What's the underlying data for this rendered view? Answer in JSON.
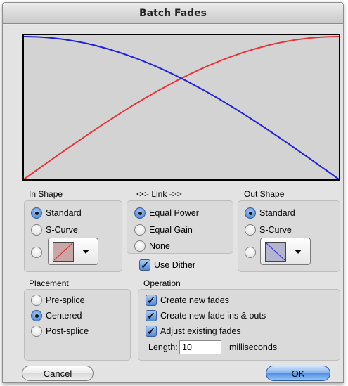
{
  "window": {
    "title": "Batch Fades"
  },
  "curves": {
    "in_color": "#e8333a",
    "out_color": "#1d1ee0",
    "background": "#d3d3d3"
  },
  "in_shape": {
    "label": "In Shape",
    "options": [
      "Standard",
      "S-Curve"
    ],
    "selected": "Standard"
  },
  "link": {
    "label": "<<- Link ->>",
    "options": [
      "Equal Power",
      "Equal Gain",
      "None"
    ],
    "selected": "Equal Power",
    "dither_label": "Use Dither",
    "dither_checked": true
  },
  "out_shape": {
    "label": "Out Shape",
    "options": [
      "Standard",
      "S-Curve"
    ],
    "selected": "Standard"
  },
  "placement": {
    "label": "Placement",
    "options": [
      "Pre-splice",
      "Centered",
      "Post-splice"
    ],
    "selected": "Centered"
  },
  "operation": {
    "label": "Operation",
    "options": [
      {
        "label": "Create new fades",
        "checked": true
      },
      {
        "label": "Create new fade ins & outs",
        "checked": true
      },
      {
        "label": "Adjust existing fades",
        "checked": true
      }
    ],
    "length_label": "Length:",
    "length_value": "10",
    "length_unit": "milliseconds"
  },
  "buttons": {
    "cancel": "Cancel",
    "ok": "OK"
  }
}
